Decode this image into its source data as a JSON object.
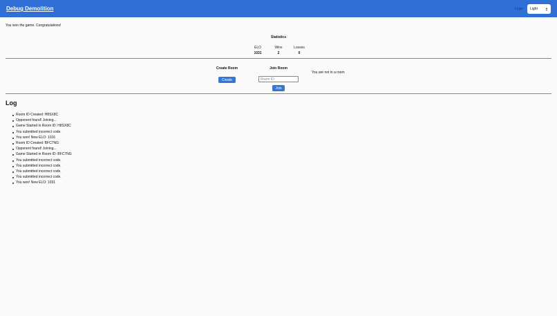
{
  "header": {
    "brand": "Debug Demolition",
    "login_label": "Login",
    "theme_value": "Light",
    "theme_arrows_up": "▲",
    "theme_arrows_down": "▼",
    "accent_color": "#2f6fd6"
  },
  "game": {
    "result_message": "You won the game. Congratulations!"
  },
  "statistics": {
    "title": "Statistics",
    "elo_label": "ELO",
    "elo_value": "1031",
    "wins_label": "Wins",
    "wins_value": "2",
    "losses_label": "Losses",
    "losses_value": "0"
  },
  "rooms": {
    "create_heading": "Create Room",
    "create_button": "Create",
    "join_heading": "Join Room",
    "room_id_placeholder": "Room ID",
    "room_id_value": "",
    "join_button": "Join",
    "status": "You are not in a room",
    "button_color": "#3575d3"
  },
  "log": {
    "title": "Log",
    "entries": [
      "Room ID Created: H8SX8C",
      "Opponent found! Joining...",
      "Game Started in Room ID: H8SX8C",
      "You submitted incorrect code.",
      "You won! New ELO: 1016",
      "Room ID Created: BFC7NG",
      "Opponent found! Joining...",
      "Game Started in Room ID: BFC7NG",
      "You submitted incorrect code.",
      "You submitted incorrect code.",
      "You submitted incorrect code.",
      "You submitted incorrect code.",
      "You won! New ELO: 1031"
    ]
  }
}
